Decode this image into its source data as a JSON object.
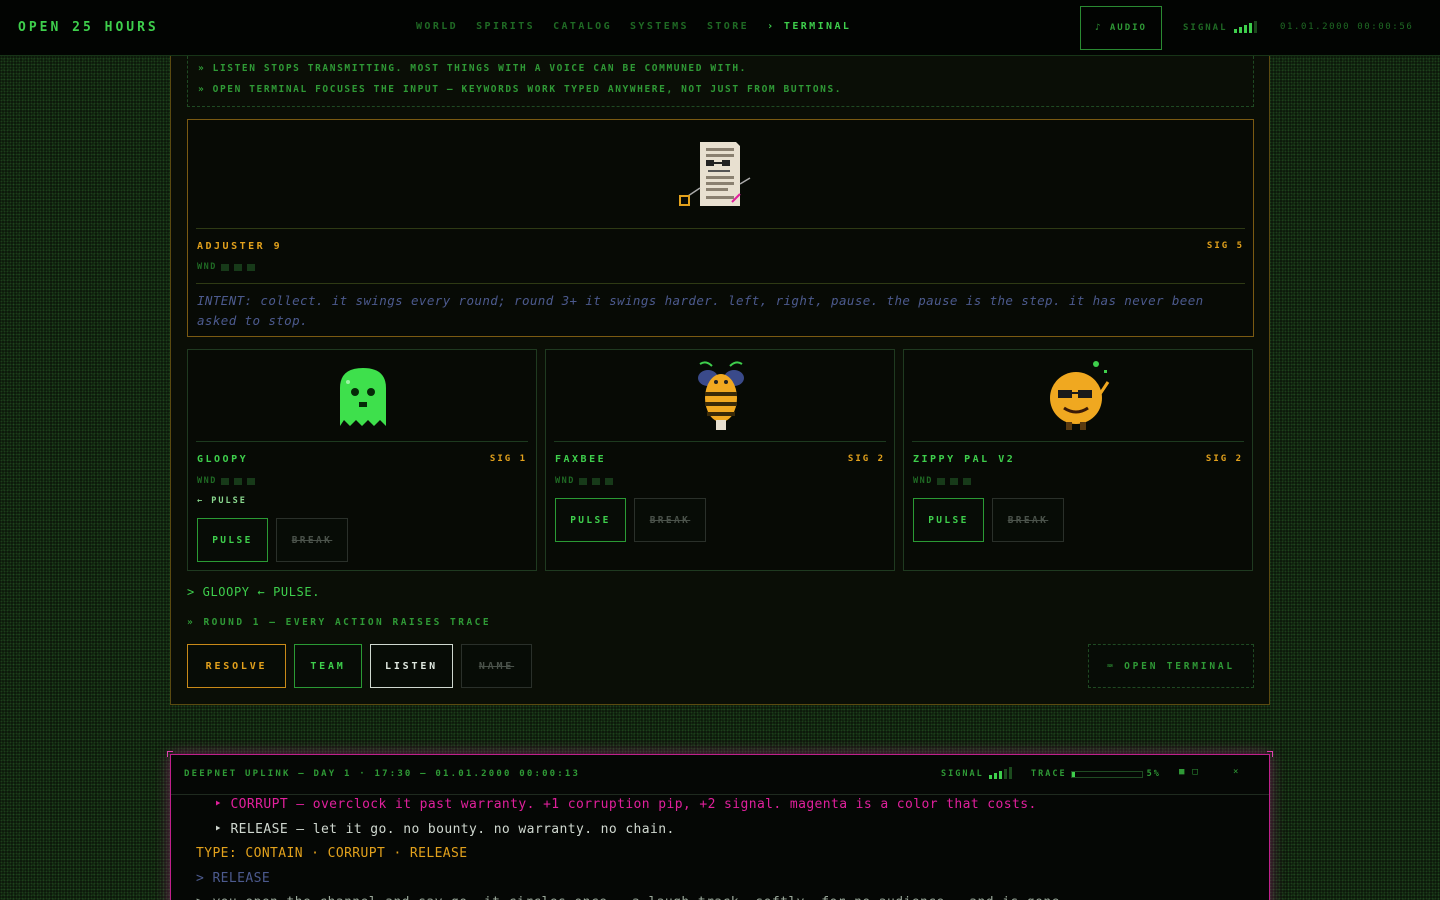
{
  "topbar": {
    "brand": "OPEN 25 HOURS",
    "nav": [
      "WORLD",
      "SPIRITS",
      "CATALOG",
      "SYSTEMS",
      "STORE",
      "› TERMINAL"
    ],
    "active_nav": "› TERMINAL",
    "audio_label": "♪ AUDIO",
    "signal_label": "SIGNAL",
    "signal_bars": 4,
    "clock": "01.01.2000 00:00:56"
  },
  "tips": [
    "» LISTEN STOPS TRANSMITTING. MOST THINGS WITH A VOICE CAN BE COMMUNED WITH.",
    "» OPEN TERMINAL FOCUSES THE INPUT — KEYWORDS WORK TYPED ANYWHERE, NOT JUST FROM BUTTONS."
  ],
  "hero": {
    "name": "ADJUSTER 9",
    "sig": "SIG 5",
    "wnd_label": "WND",
    "wnd_pips": 3,
    "intent": "INTENT: collect. it swings every round; round 3+ it swings harder. left, right, pause. the pause is the step. it has never been asked to stop."
  },
  "cards": [
    {
      "name": "GLOOPY",
      "sig": "SIG 1",
      "wnd_label": "WND",
      "last": "← PULSE",
      "pulse_label": "PULSE",
      "break_label": "BREAK",
      "color": "#3ecf4c"
    },
    {
      "name": "FAXBEE",
      "sig": "SIG 2",
      "wnd_label": "WND",
      "last": "",
      "pulse_label": "PULSE",
      "break_label": "BREAK",
      "color": "#f0a820"
    },
    {
      "name": "ZIPPY PAL V2",
      "sig": "SIG 2",
      "wnd_label": "WND",
      "last": "",
      "pulse_label": "PULSE",
      "break_label": "BREAK",
      "color": "#f0a820"
    }
  ],
  "log_line": "> GLOOPY ← PULSE.",
  "round_line": "» ROUND 1 — EVERY ACTION RAISES TRACE",
  "actions": {
    "resolve": "RESOLVE",
    "team": "TEAM",
    "listen": "LISTEN",
    "name": "NAME",
    "open_terminal": "⌨ OPEN TERMINAL"
  },
  "uplink": {
    "title": "DEEPNET UPLINK — DAY 1 · 17:30 — 01.01.2000 00:00:13",
    "signal_label": "SIGNAL",
    "trace_label": "TRACE",
    "trace_value": "5%",
    "trace_fraction": 0.05,
    "controls": [
      "■",
      "□"
    ],
    "close": "×",
    "lines": {
      "corrupt": "‣ CORRUPT — overclock it past warranty. +1 corruption pip, +2 signal. magenta is a color that costs.",
      "release": "‣ RELEASE — let it go. no bounty. no warranty. no chain.",
      "type": "TYPE: CONTAIN · CORRUPT · RELEASE",
      "input": "> RELEASE",
      "output": "> you open the channel and say go. it circles once — a laugh track, softly, for no audience — and is gone."
    }
  },
  "colors": {
    "accent_green": "#3ecf4c",
    "accent_amber": "#e2a11c",
    "accent_magenta": "#e0209c",
    "intent_blue": "#4c5a8e"
  }
}
